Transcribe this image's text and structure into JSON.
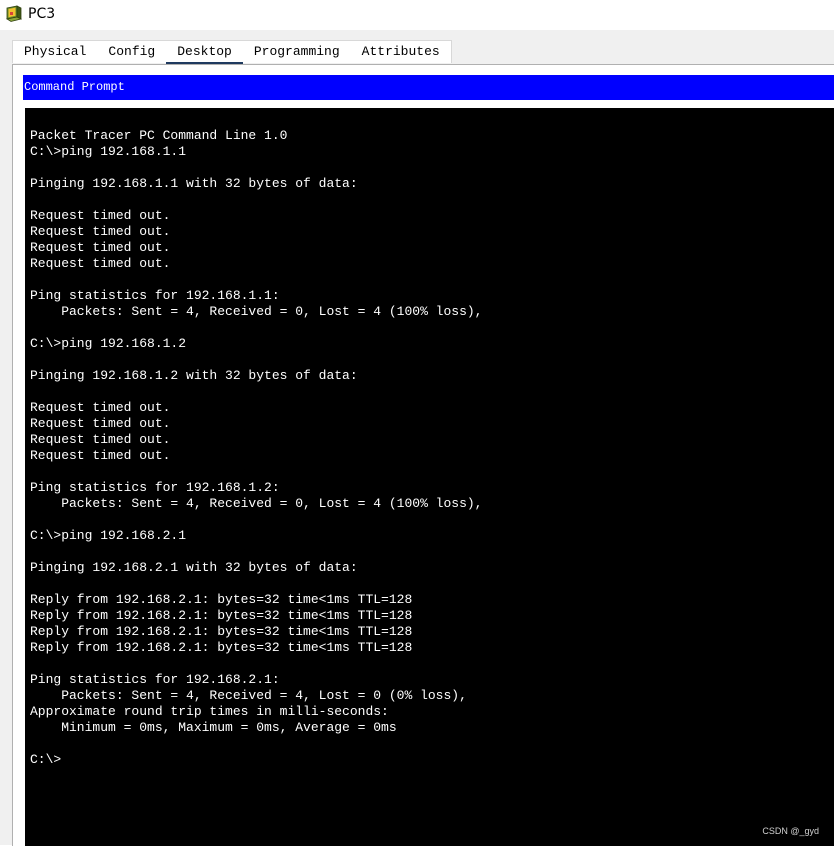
{
  "window": {
    "title": "PC3",
    "icon": "pc-icon"
  },
  "tabs": [
    {
      "label": "Physical",
      "active": false
    },
    {
      "label": "Config",
      "active": false
    },
    {
      "label": "Desktop",
      "active": true
    },
    {
      "label": "Programming",
      "active": false
    },
    {
      "label": "Attributes",
      "active": false
    }
  ],
  "command_prompt": {
    "title": "Command Prompt",
    "output": "Packet Tracer PC Command Line 1.0\nC:\\>ping 192.168.1.1\n\nPinging 192.168.1.1 with 32 bytes of data:\n\nRequest timed out.\nRequest timed out.\nRequest timed out.\nRequest timed out.\n\nPing statistics for 192.168.1.1:\n    Packets: Sent = 4, Received = 0, Lost = 4 (100% loss),\n\nC:\\>ping 192.168.1.2\n\nPinging 192.168.1.2 with 32 bytes of data:\n\nRequest timed out.\nRequest timed out.\nRequest timed out.\nRequest timed out.\n\nPing statistics for 192.168.1.2:\n    Packets: Sent = 4, Received = 0, Lost = 4 (100% loss),\n\nC:\\>ping 192.168.2.1\n\nPinging 192.168.2.1 with 32 bytes of data:\n\nReply from 192.168.2.1: bytes=32 time<1ms TTL=128\nReply from 192.168.2.1: bytes=32 time<1ms TTL=128\nReply from 192.168.2.1: bytes=32 time<1ms TTL=128\nReply from 192.168.2.1: bytes=32 time<1ms TTL=128\n\nPing statistics for 192.168.2.1:\n    Packets: Sent = 4, Received = 4, Lost = 0 (0% loss),\nApproximate round trip times in milli-seconds:\n    Minimum = 0ms, Maximum = 0ms, Average = 0ms\n\nC:\\>"
  },
  "watermark": "CSDN @_gyd",
  "colors": {
    "header_bg": "#0000ff",
    "header_text": "#ffffff",
    "terminal_bg": "#000000",
    "terminal_text": "#ffffff",
    "active_tab_underline": "#1f3a5f"
  }
}
